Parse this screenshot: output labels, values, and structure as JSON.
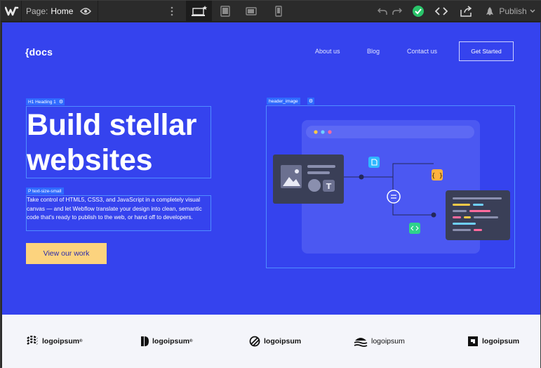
{
  "toolbar": {
    "page_prefix": "Page:",
    "page_name": "Home",
    "publish_label": "Publish",
    "icons": [
      "webflow-logo-icon",
      "eye-icon",
      "more-dots-icon",
      "desktop-breakpoint-icon",
      "tablet-breakpoint-icon",
      "mobile-landscape-icon",
      "mobile-portrait-icon",
      "undo-icon",
      "redo-icon",
      "check-status-icon",
      "code-icon",
      "export-icon",
      "publish-rocket-icon",
      "chevron-down-icon"
    ],
    "colors": {
      "bar": "#2b2b2b",
      "check": "#29c46a"
    }
  },
  "site": {
    "logo": "{docs",
    "nav": [
      "About us",
      "Blog",
      "Contact us"
    ],
    "get_started": "Get Started",
    "hero_bg": "#3543ee"
  },
  "selection_tags": {
    "heading": "H1 Heading 1",
    "paragraph": "P text-size-small",
    "image": "header_image"
  },
  "hero": {
    "heading": "Build stellar websites",
    "paragraph": "Take control of HTML5, CSS3, and JavaScript in a completely visual canvas — and let Webflow translate your design into clean, semantic code that's ready to publish to the web, or hand off to developers.",
    "cta": "View our work",
    "cta_color": "#fcd37e"
  },
  "logos": [
    "logoipsum",
    "logoipsum",
    "logoipsum",
    "logoipsum",
    "logoipsum"
  ]
}
